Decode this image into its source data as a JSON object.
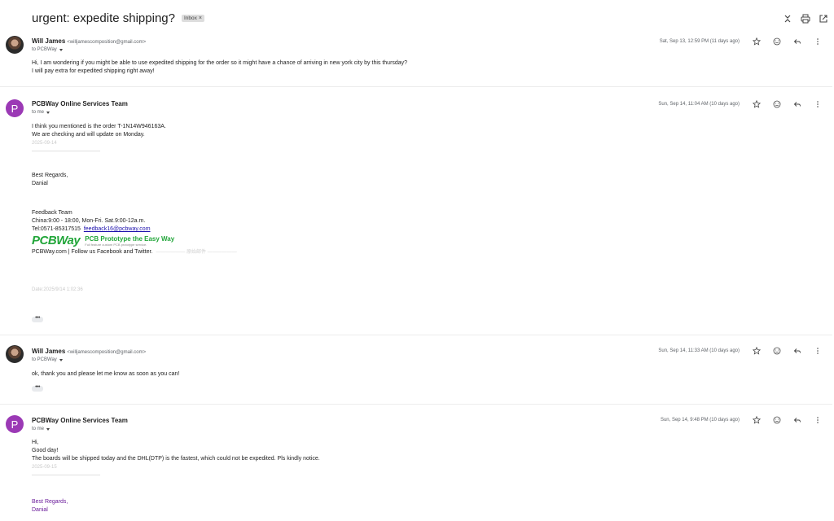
{
  "thread": {
    "subject": "urgent: expedite shipping?",
    "label": "Inbox",
    "label_close": "×"
  },
  "top_icons": [
    "collapse-icon",
    "print-icon",
    "open-in-new-window-icon"
  ],
  "messages": [
    {
      "sender": "Will James",
      "email": "<willjamescomposition@gmail.com>",
      "to": "to PCBWay",
      "date": "Sat, Sep 13, 12:59 PM (11 days ago)",
      "avatar": "photo",
      "body": [
        "Hi, I am wondering if you might be able to use expedited shipping for the order so it might have a chance of arriving in new york city by this thursday?",
        "I will pay extra for expedited shipping right away!"
      ]
    },
    {
      "sender": "PCBWay Online Services Team",
      "to": "to me",
      "date": "Sun, Sep 14, 11:04 AM (10 days ago)",
      "avatar_letter": "P",
      "body": [
        "I think you mentioned is the order T-1N14W946163A.",
        "We are checking and will update on Monday."
      ],
      "faded_date": "2025-09-14",
      "signoff": [
        "Best Regards,",
        "Danial"
      ],
      "feedback": [
        "Feedback Team",
        "China:9:00 - 18:00, Mon-Fri. Sat.9:00-12a.m."
      ],
      "tel": "Tel:0571-85317515",
      "tel_link": "feedback16@pcbway.com",
      "logo_main": "PCBWay",
      "logo_tag": "PCB Prototype the Easy Way",
      "logo_small": "Full feature custom PCB prototype service.",
      "follow": "PCBWay.com | Follow us Facebook  and Twitter.",
      "follow_faded": "—————— 原始邮件 ——————",
      "faded_datetime": "Date:2025/9/14 1:02:36",
      "dots": "•••"
    },
    {
      "sender": "Will James",
      "email": "<willjamescomposition@gmail.com>",
      "to": "to PCBWay",
      "date": "Sun, Sep 14, 11:33 AM (10 days ago)",
      "avatar": "photo",
      "body": [
        "ok, thank you and please let me know as soon as you can!"
      ],
      "dots": "•••"
    },
    {
      "sender": "PCBWay Online Services Team",
      "to": "to me",
      "date": "Sun, Sep 14, 9:48 PM (10 days ago)",
      "avatar_letter": "P",
      "body": [
        "Hi,",
        "Good day!",
        "The boards will be shipped today and the DHL(DTP) is the fastest, which could not be expedited. Pls kindly notice."
      ],
      "faded_date": "2025-09-15",
      "signoff": [
        "Best Regards,",
        "Danial"
      ]
    }
  ],
  "message_icons": [
    "star-icon",
    "emoji-icon",
    "reply-icon",
    "more-vert-icon"
  ]
}
